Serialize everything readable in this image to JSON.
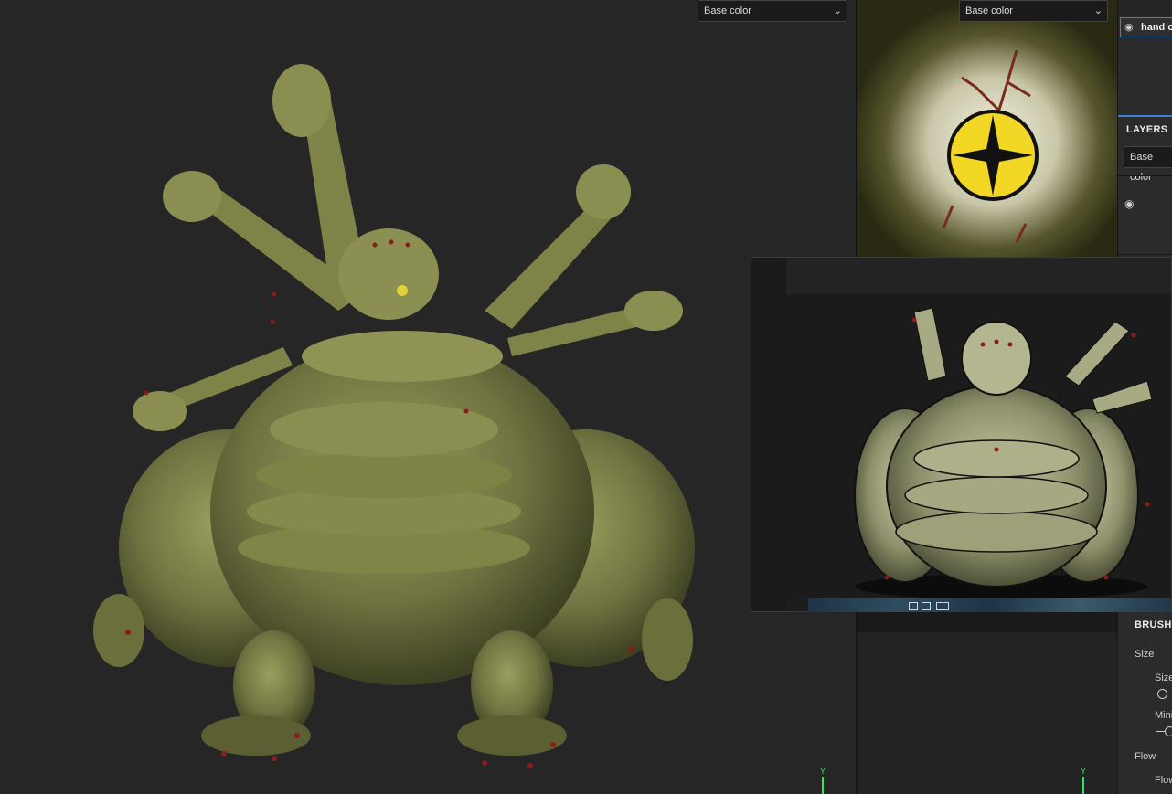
{
  "viewport3d": {
    "channel_select": "Base color",
    "axis_label": "Y"
  },
  "viewport2d": {
    "channel_select": "Base color",
    "axis_label": "Y"
  },
  "texture_set_list": {
    "item_label": "hand c"
  },
  "layers_panel": {
    "title": "LAYERS",
    "channel_select": "Base color"
  },
  "brush_panel": {
    "title": "BRUSH",
    "size_section": "Size",
    "size_param": "Size",
    "min_param": "Mini",
    "flow_section": "Flow",
    "flow_param": "Flow"
  },
  "icons": {
    "dropdown": "chevron-down-icon",
    "visibility": "eye-icon"
  },
  "colors": {
    "accent_blue": "#3b82d6",
    "axis_green": "#38e06a",
    "model_green": "#7a7e45",
    "fingernail_red": "#8a1c1c"
  }
}
